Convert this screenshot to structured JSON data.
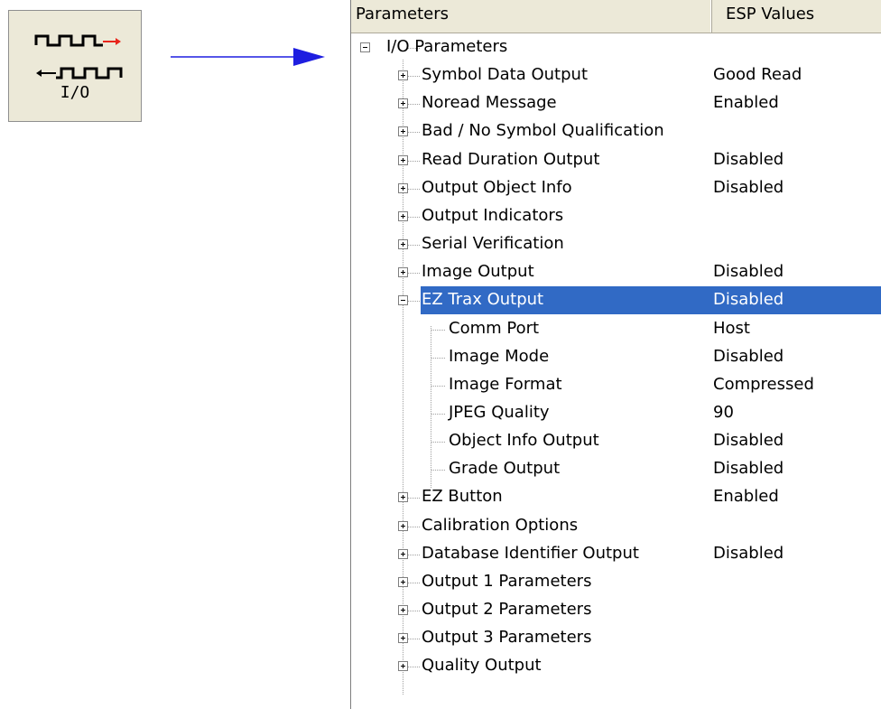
{
  "io_button": {
    "label": "I/O",
    "icon": "io-signal-icon",
    "out_arrow_color": "#e8251c"
  },
  "pointer": {
    "color": "#1e1ee0"
  },
  "table": {
    "col_parameters": "Parameters",
    "col_values": "ESP Values"
  },
  "tree": {
    "root": {
      "label": "I/O Parameters",
      "expanded": true
    },
    "items": [
      {
        "label": "Symbol Data Output",
        "value": "Good Read",
        "expanded": false
      },
      {
        "label": "Noread Message",
        "value": "Enabled",
        "expanded": false
      },
      {
        "label": "Bad / No Symbol Qualification",
        "value": "",
        "expanded": false
      },
      {
        "label": "Read Duration Output",
        "value": "Disabled",
        "expanded": false
      },
      {
        "label": "Output Object Info",
        "value": "Disabled",
        "expanded": false
      },
      {
        "label": "Output Indicators",
        "value": "",
        "expanded": false
      },
      {
        "label": "Serial Verification",
        "value": "",
        "expanded": false
      },
      {
        "label": "Image Output",
        "value": "Disabled",
        "expanded": false
      },
      {
        "label": "EZ Trax Output",
        "value": "Disabled",
        "expanded": true,
        "selected": true,
        "children": [
          {
            "label": "Comm Port",
            "value": "Host"
          },
          {
            "label": "Image Mode",
            "value": "Disabled"
          },
          {
            "label": "Image Format",
            "value": "Compressed"
          },
          {
            "label": "JPEG Quality",
            "value": "90"
          },
          {
            "label": "Object Info Output",
            "value": "Disabled"
          },
          {
            "label": "Grade Output",
            "value": "Disabled"
          }
        ]
      },
      {
        "label": "EZ Button",
        "value": "Enabled",
        "expanded": false
      },
      {
        "label": "Calibration Options",
        "value": "",
        "expanded": false
      },
      {
        "label": "Database Identifier Output",
        "value": "Disabled",
        "expanded": false
      },
      {
        "label": "Output 1 Parameters",
        "value": "",
        "expanded": false
      },
      {
        "label": "Output 2 Parameters",
        "value": "",
        "expanded": false
      },
      {
        "label": "Output 3 Parameters",
        "value": "",
        "expanded": false
      },
      {
        "label": "Quality Output",
        "value": "",
        "expanded": false
      }
    ]
  },
  "colors": {
    "selection": "#316ac5",
    "header_bg": "#ece9d8"
  }
}
